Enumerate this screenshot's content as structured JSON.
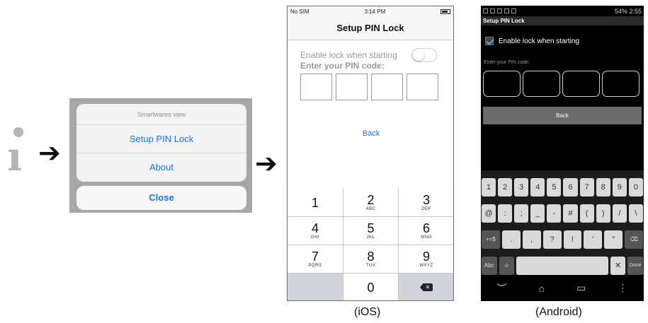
{
  "action_sheet": {
    "title": "Smartwares view",
    "options": [
      "Setup PIN Lock",
      "About"
    ],
    "close_label": "Close"
  },
  "ios": {
    "status": {
      "carrier": "No SIM",
      "time": "3:14 PM"
    },
    "nav_title": "Setup PIN Lock",
    "enable_label": "Enable lock when starting",
    "enter_label": "Enter your PIN code:",
    "back_label": "Back",
    "keys": [
      {
        "n": "1",
        "l": ""
      },
      {
        "n": "2",
        "l": "ABC"
      },
      {
        "n": "3",
        "l": "DEF"
      },
      {
        "n": "4",
        "l": "GHI"
      },
      {
        "n": "5",
        "l": "JKL"
      },
      {
        "n": "6",
        "l": "MNO"
      },
      {
        "n": "7",
        "l": "PQRS"
      },
      {
        "n": "8",
        "l": "TUV"
      },
      {
        "n": "9",
        "l": "WXYZ"
      },
      {
        "n": "",
        "l": ""
      },
      {
        "n": "0",
        "l": ""
      },
      {
        "n": "delete",
        "l": ""
      }
    ],
    "caption": "(iOS)"
  },
  "android": {
    "status": {
      "battery": "54%",
      "time": "2:55"
    },
    "title": "Setup PIN Lock",
    "enable_label": "Enable lock when starting",
    "enter_label": "Enter your PIN code:",
    "back_label": "Back",
    "row1": [
      "1",
      "2",
      "3",
      "4",
      "5",
      "6",
      "7",
      "8",
      "9",
      "0"
    ],
    "row2": [
      "@",
      ":",
      ";",
      "_",
      "-",
      "#",
      "(",
      ")",
      "/",
      "\\"
    ],
    "row3": [
      "+=$",
      ".",
      ",",
      "?",
      "!",
      "'",
      "\"",
      "⌫"
    ],
    "row4": {
      "abc": "Abc",
      "done": "Done"
    },
    "caption": "(Android)"
  },
  "colors": {
    "accent_blue": "#1a73d9",
    "android_accent": "#33b5e5",
    "sheet_overlay": "#a7a7a7"
  }
}
